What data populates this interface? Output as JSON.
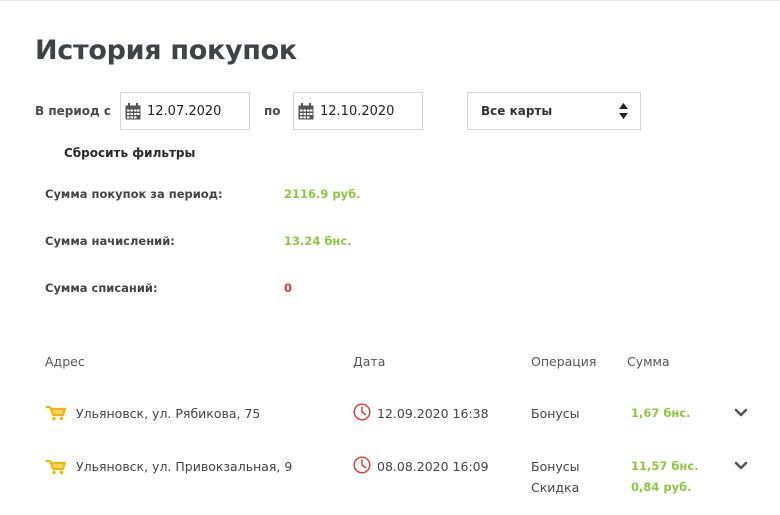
{
  "page": {
    "title": "История покупок"
  },
  "filters": {
    "period_from_label": "В период с",
    "date_from": "12.07.2020",
    "period_to_label": "по",
    "date_to": "12.10.2020",
    "cards_select": "Все карты",
    "reset_label": "Сбросить фильтры"
  },
  "summary": [
    {
      "label": "Сумма покупок за период:",
      "value": "2116.9 руб.",
      "color": "#8cc63f"
    },
    {
      "label": "Сумма начислений:",
      "value": "13.24 бнс.",
      "color": "#8cc63f"
    },
    {
      "label": "Сумма списаний:",
      "value": "0",
      "color": "#e5352f"
    }
  ],
  "table": {
    "headers": {
      "address": "Адрес",
      "date": "Дата",
      "operation": "Операция",
      "amount": "Сумма"
    },
    "rows": [
      {
        "address": "Ульяновск, ул. Рябикова, 75",
        "datetime": "12.09.2020 16:38",
        "op1": "Бонусы",
        "amt1": "1,67 бнс.",
        "op2": "",
        "amt2": ""
      },
      {
        "address": "Ульяновск, ул. Привокзальная, 9",
        "datetime": "08.08.2020 16:09",
        "op1": "Бонусы",
        "amt1": "11,57 бнс.",
        "op2": "Скидка",
        "amt2": "0,84 руб."
      }
    ]
  },
  "icons": {
    "calendar": "calendar-icon",
    "select_arrows": "sort-arrows-icon",
    "store": "shopping-cart-icon",
    "clock": "clock-icon",
    "expand": "chevron-down-icon"
  },
  "colors": {
    "accent_green": "#8cc63f",
    "accent_red": "#e5352f",
    "clock_red": "#e0392b",
    "cart_yellow": "#f5b400"
  }
}
